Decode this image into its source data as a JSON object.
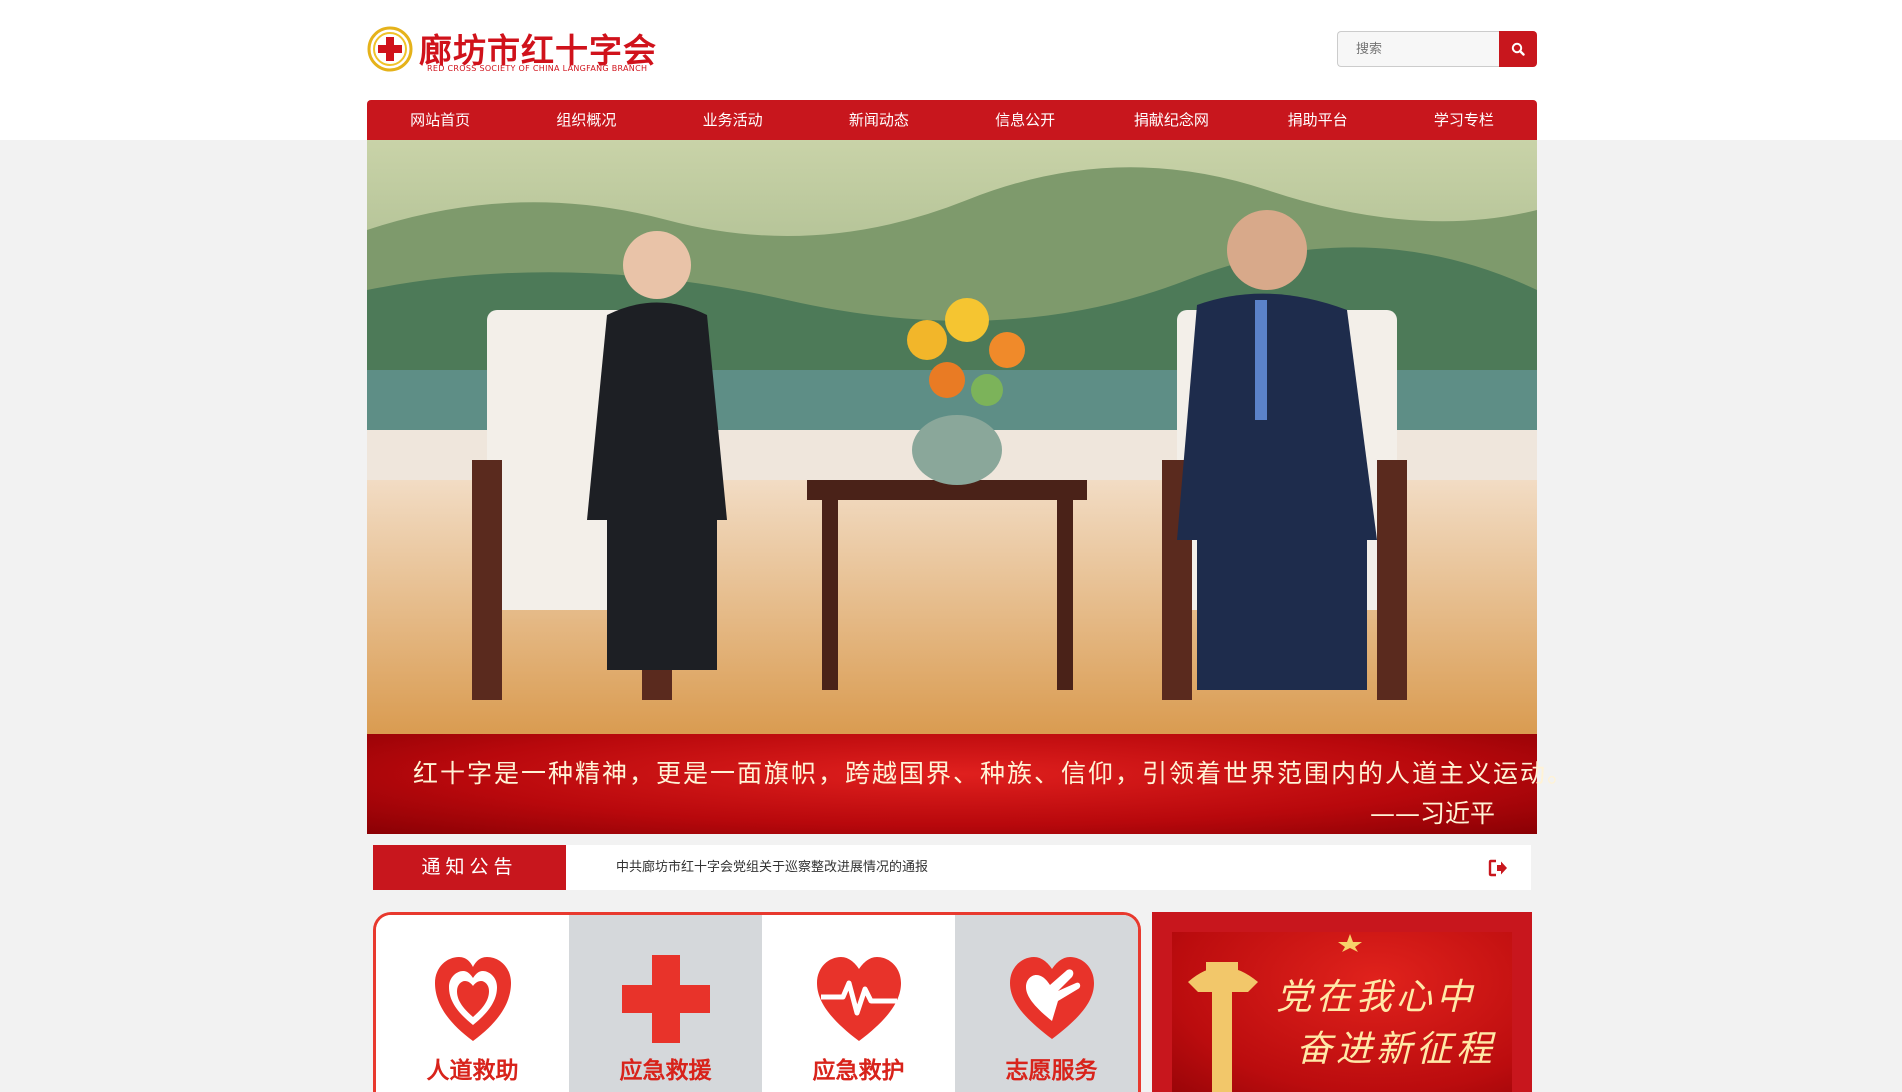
{
  "header": {
    "logo_title": "廊坊市红十字会",
    "logo_subtitle": "RED CROSS SOCIETY OF CHINA LANGFANG BRANCH",
    "search_placeholder": "搜索",
    "search_icon": "search-icon"
  },
  "nav": {
    "items": [
      {
        "label": "网站首页"
      },
      {
        "label": "组织概况"
      },
      {
        "label": "业务活动"
      },
      {
        "label": "新闻动态"
      },
      {
        "label": "信息公开"
      },
      {
        "label": "捐献纪念网"
      },
      {
        "label": "捐助平台"
      },
      {
        "label": "学习专栏"
      }
    ]
  },
  "banner": {
    "quote": "红十字是一种精神，更是一面旗帜，跨越国界、种族、信仰，引领着世界范围内的人道主义运动。",
    "author": "——习近平"
  },
  "notice": {
    "label": "通知公告",
    "text": "中共廊坊市红十字会党组关于巡察整改进展情况的通报",
    "more_icon": "sign-out-icon"
  },
  "services": [
    {
      "label": "人道救助",
      "icon": "heart-hands-icon"
    },
    {
      "label": "应急救援",
      "icon": "red-cross-icon"
    },
    {
      "label": "应急救护",
      "icon": "heartbeat-icon"
    },
    {
      "label": "志愿服务",
      "icon": "heart-hand-icon"
    }
  ],
  "party_banner": {
    "line1": "党在我心中",
    "line2": "奋进新征程"
  },
  "colors": {
    "brand_red": "#c8161d",
    "accent_red": "#e8392e",
    "page_bg": "#f2f2f2"
  }
}
